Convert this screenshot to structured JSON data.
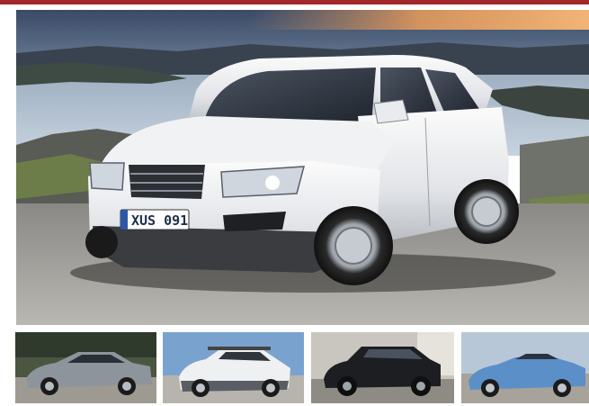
{
  "hero": {
    "vehicle": "white-suv",
    "plate_text": "XUS 091"
  },
  "thumbnails": [
    {
      "vehicle": "grey-sedan"
    },
    {
      "vehicle": "white-crossover-wagon"
    },
    {
      "vehicle": "black-suv"
    },
    {
      "vehicle": "blue-convertible"
    }
  ],
  "colors": {
    "accent_strip": "#a3282c",
    "background": "#ffffff"
  }
}
